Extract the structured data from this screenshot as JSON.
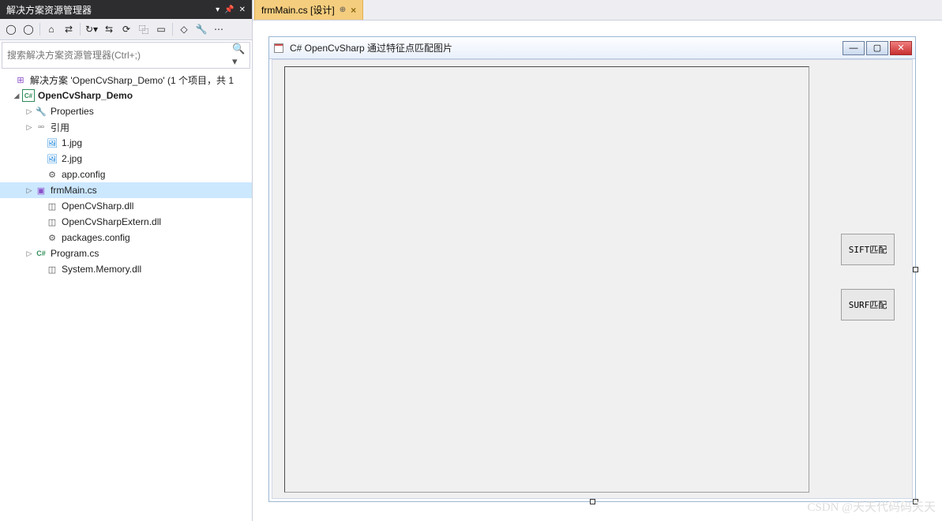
{
  "panel": {
    "title": "解决方案资源管理器",
    "search_placeholder": "搜索解决方案资源管理器(Ctrl+;)"
  },
  "tree": {
    "solution": "解决方案 'OpenCvSharp_Demo' (1 个项目，共 1",
    "project": "OpenCvSharp_Demo",
    "properties": "Properties",
    "references": "引用",
    "img1": "1.jpg",
    "img2": "2.jpg",
    "appconfig": "app.config",
    "frmmain": "frmMain.cs",
    "dll1": "OpenCvSharp.dll",
    "dll2": "OpenCvSharpExtern.dll",
    "packages": "packages.config",
    "program": "Program.cs",
    "dll3": "System.Memory.dll"
  },
  "tab": {
    "label": "frmMain.cs [设计]"
  },
  "form": {
    "title": "C# OpenCvSharp 通过特征点匹配图片",
    "btn_sift": "SIFT匹配",
    "btn_surf": "SURF匹配"
  },
  "watermark": "CSDN @天天代码码天天"
}
